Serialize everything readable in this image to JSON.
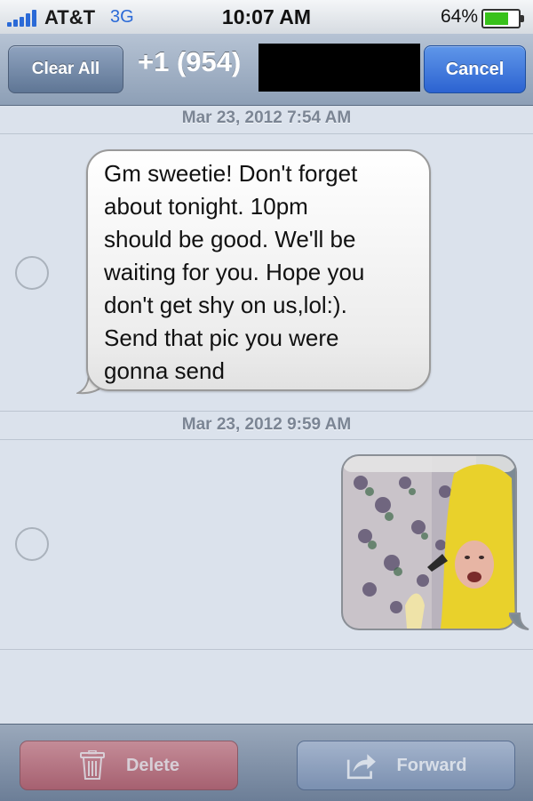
{
  "status_bar": {
    "carrier": "AT&T",
    "network": "3G",
    "time": "10:07 AM",
    "battery_percent": "64%",
    "battery_level": 0.64,
    "signal_icon": "signal-bars-icon",
    "battery_icon": "battery-icon"
  },
  "nav_bar": {
    "clear_all_label": "Clear All",
    "title": "+1 (954)",
    "cancel_label": "Cancel"
  },
  "messages": [
    {
      "timestamp": "Mar 23, 2012 7:54 AM",
      "type": "text",
      "lines": [
        "Gm sweetie! Don't forget",
        "about tonight. 10pm",
        "should be good. We'll be",
        "waiting for you. Hope you",
        "don't get shy on us,lol:).",
        "Send that pic you were",
        "gonna send"
      ]
    },
    {
      "timestamp": "Mar 23, 2012 9:59 AM",
      "type": "image"
    }
  ],
  "toolbar": {
    "delete_label": "Delete",
    "delete_icon": "trash-icon",
    "forward_label": "Forward",
    "forward_icon": "forward-arrow-icon"
  },
  "colors": {
    "background": "#dbe2ec",
    "cancel_blue": "#2c63d1",
    "delete_red": "#b85562",
    "battery_green": "#38c11b"
  }
}
